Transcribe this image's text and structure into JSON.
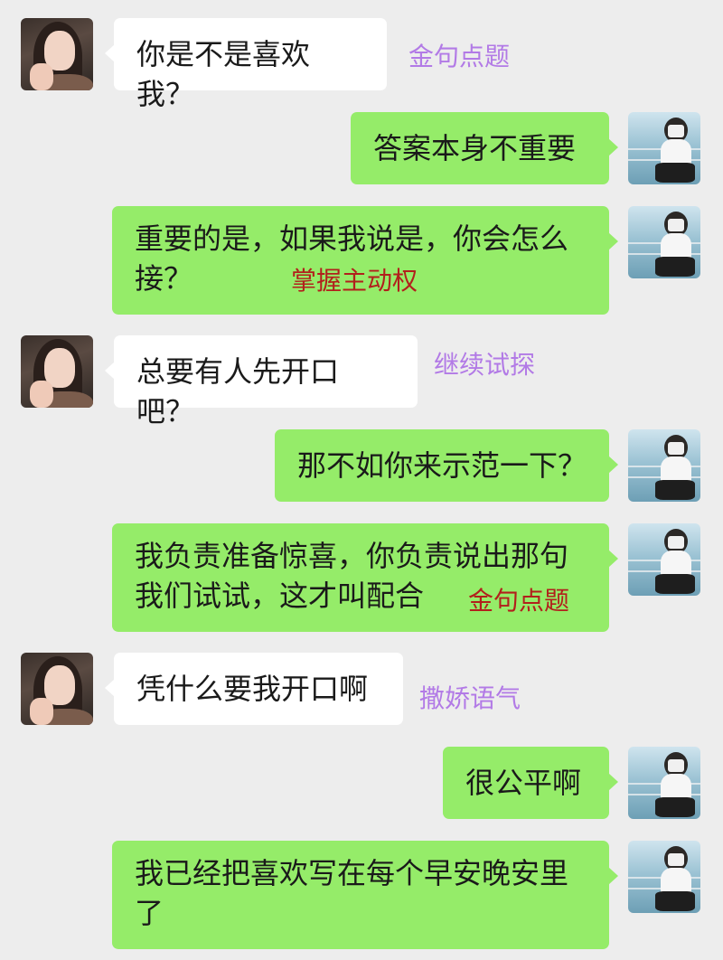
{
  "colors": {
    "background": "#ededed",
    "received_bubble": "#ffffff",
    "sent_bubble": "#95ec69",
    "annotation_purple": "#b27ae6",
    "annotation_red": "#b2201c"
  },
  "messages": [
    {
      "side": "received",
      "text": "你是不是喜欢我？",
      "annotation": "金句点题",
      "annotation_color": "purple"
    },
    {
      "side": "sent",
      "text": "答案本身不重要"
    },
    {
      "side": "sent",
      "text_line1": "重要的是，如果我说是，你会怎么",
      "text_line2": "接？",
      "annotation": "掌握主动权",
      "annotation_color": "red"
    },
    {
      "side": "received",
      "text": "总要有人先开口吧？",
      "annotation": "继续试探",
      "annotation_color": "purple"
    },
    {
      "side": "sent",
      "text": "那不如你来示范一下？"
    },
    {
      "side": "sent",
      "text_line1": "我负责准备惊喜，你负责说出那句",
      "text_line2": "我们试试，这才叫配合",
      "annotation": "金句点题",
      "annotation_color": "red"
    },
    {
      "side": "received",
      "text": "凭什么要我开口啊",
      "annotation": "撒娇语气",
      "annotation_color": "purple"
    },
    {
      "side": "sent",
      "text": "很公平啊"
    },
    {
      "side": "sent",
      "text_line1": "我已经把喜欢写在每个早安晚安里",
      "text_line2": "了"
    }
  ]
}
